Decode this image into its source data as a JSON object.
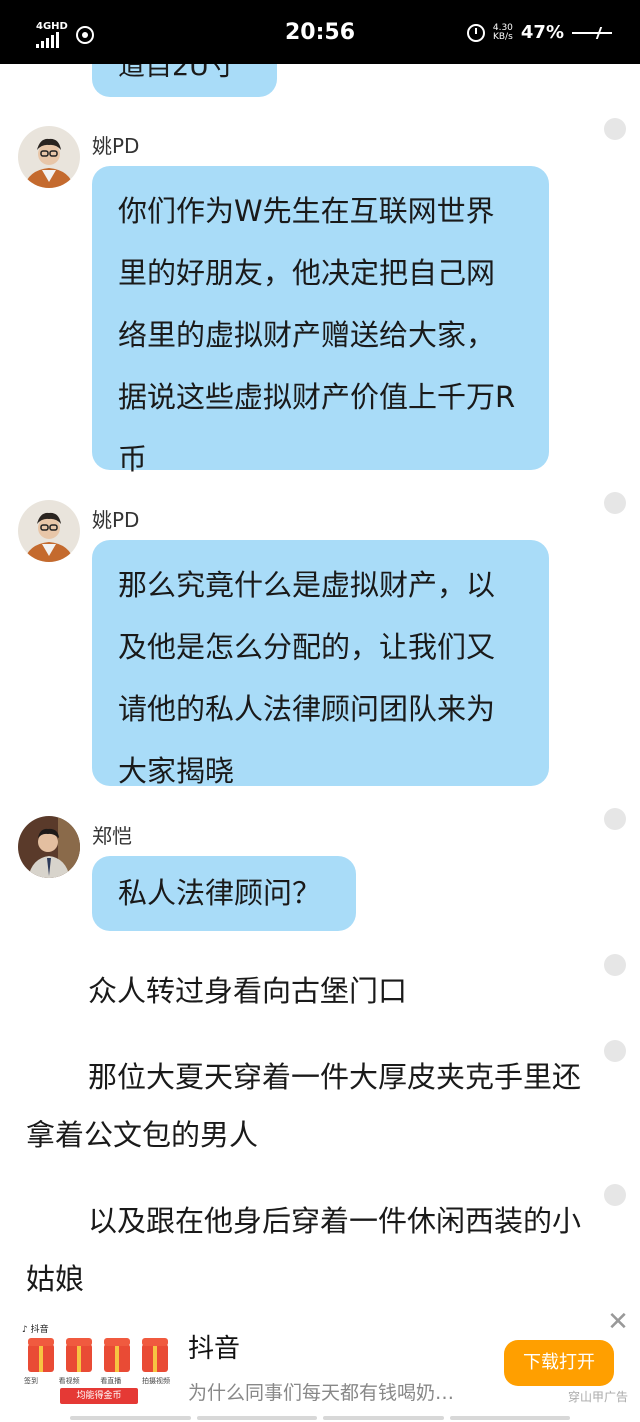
{
  "status_bar": {
    "network": "4GHD",
    "time": "20:56",
    "speed_value": "4.30",
    "speed_unit": "KB/s",
    "battery": "47%"
  },
  "top_partial_text": "道自2U寸",
  "messages": [
    {
      "name": "姚PD",
      "text": "你们作为W先生在互联网世界里的好朋友，他决定把自己网络里的虚拟财产赠送给大家，据说这些虚拟财产价值上千万R币"
    },
    {
      "name": "姚PD",
      "text": "那么究竟什么是虚拟财产，以及他是怎么分配的，让我们又请他的私人法律顾问团队来为大家揭晓"
    },
    {
      "name": "郑恺",
      "text": "私人法律顾问？"
    }
  ],
  "narration": [
    "众人转过身看向古堡门口",
    "那位大夏天穿着一件大厚皮夹克手里还拿着公文包的男人",
    "以及跟在他身后穿着一件休闲西装的小姑娘"
  ],
  "ad": {
    "brand_small": "抖音",
    "title": "抖音",
    "description": "为什么同事们每天都有钱喝奶…",
    "button": "下载打开",
    "tag": "穿山甲广告",
    "thumb_cta": "均能得金币",
    "thumb_labels": [
      "签到",
      "看视频",
      "看直播",
      "拍摄视频"
    ],
    "close_symbol": "✕"
  },
  "colors": {
    "bubble": "#a9dcf8",
    "ad_button": "#ff9f00",
    "status_bar": "#000000"
  }
}
